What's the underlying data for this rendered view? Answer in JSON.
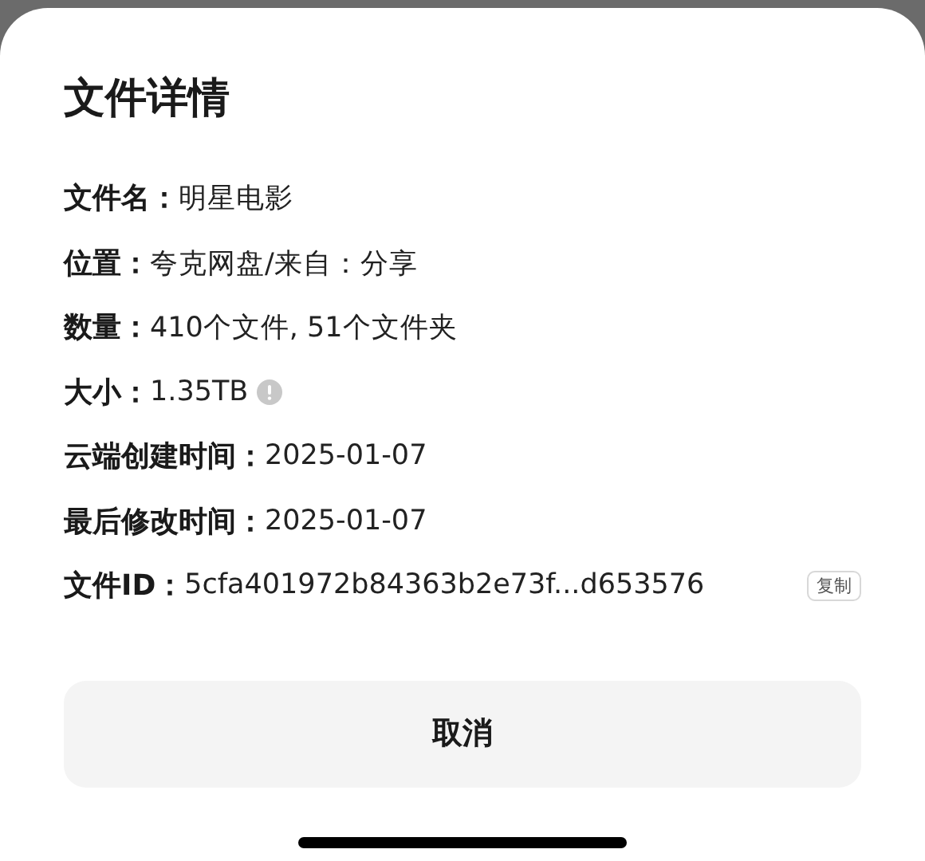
{
  "sheet": {
    "title": "文件详情"
  },
  "details": [
    {
      "kind": "plain",
      "label": "文件名：",
      "value": "明星电影"
    },
    {
      "kind": "plain",
      "label": "位置：",
      "value": "夸克网盘/来自：分享"
    },
    {
      "kind": "plain",
      "label": "数量：",
      "value": "410个文件, 51个文件夹"
    },
    {
      "kind": "info",
      "label": "大小：",
      "value": "1.35TB"
    },
    {
      "kind": "plain",
      "label": "云端创建时间：",
      "value": "2025-01-07"
    },
    {
      "kind": "plain",
      "label": "最后修改时间：",
      "value": "2025-01-07"
    },
    {
      "kind": "copy",
      "label": "文件ID：",
      "value": "5cfa401972b84363b2e73f...d653576",
      "action": "复制"
    }
  ],
  "cancel_button": "取消"
}
